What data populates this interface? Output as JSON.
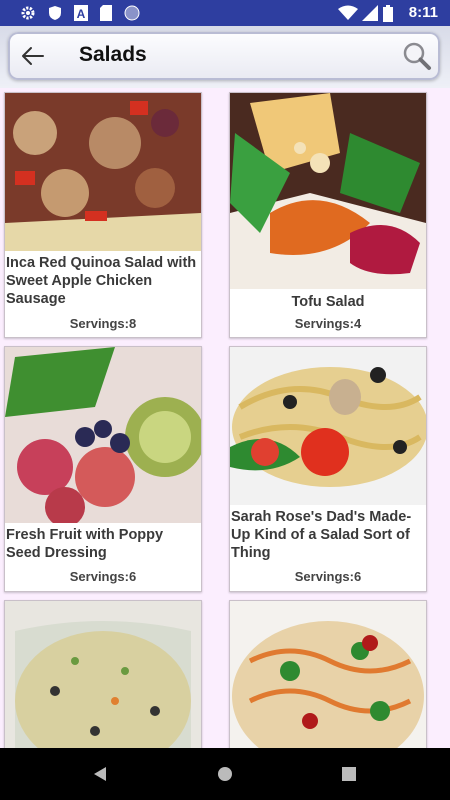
{
  "status_bar": {
    "time": "8:11",
    "left_icons": [
      "gear-icon",
      "shield-icon",
      "a-letter-icon",
      "sd-card-icon",
      "circle-icon"
    ],
    "right_icons": [
      "wifi-icon",
      "signal-icon",
      "battery-icon"
    ]
  },
  "app_bar": {
    "title": "Salads",
    "back_icon": "back-arrow-icon",
    "search_icon": "search-icon"
  },
  "recipes": [
    {
      "name": "Inca Red Quinoa Salad with Sweet Apple Chicken Sausage",
      "servings": "Servings:8",
      "image": "quinoa salad photo"
    },
    {
      "name": "Tofu Salad",
      "servings": "Servings:4",
      "image": "tofu salad photo"
    },
    {
      "name": "Fresh Fruit with Poppy Seed Dressing",
      "servings": "Servings:6",
      "image": "fruit salad photo"
    },
    {
      "name": "Sarah Rose's Dad's Made-Up Kind of a Salad Sort of Thing",
      "servings": "Servings:6",
      "image": "pasta salad photo"
    },
    {
      "name": "",
      "servings": "",
      "image": "grain salad in bowl photo"
    },
    {
      "name": "",
      "servings": "",
      "image": "orzo salad photo"
    }
  ],
  "nav_bar": {
    "icons": [
      "back-triangle-icon",
      "home-circle-icon",
      "recents-square-icon"
    ]
  }
}
